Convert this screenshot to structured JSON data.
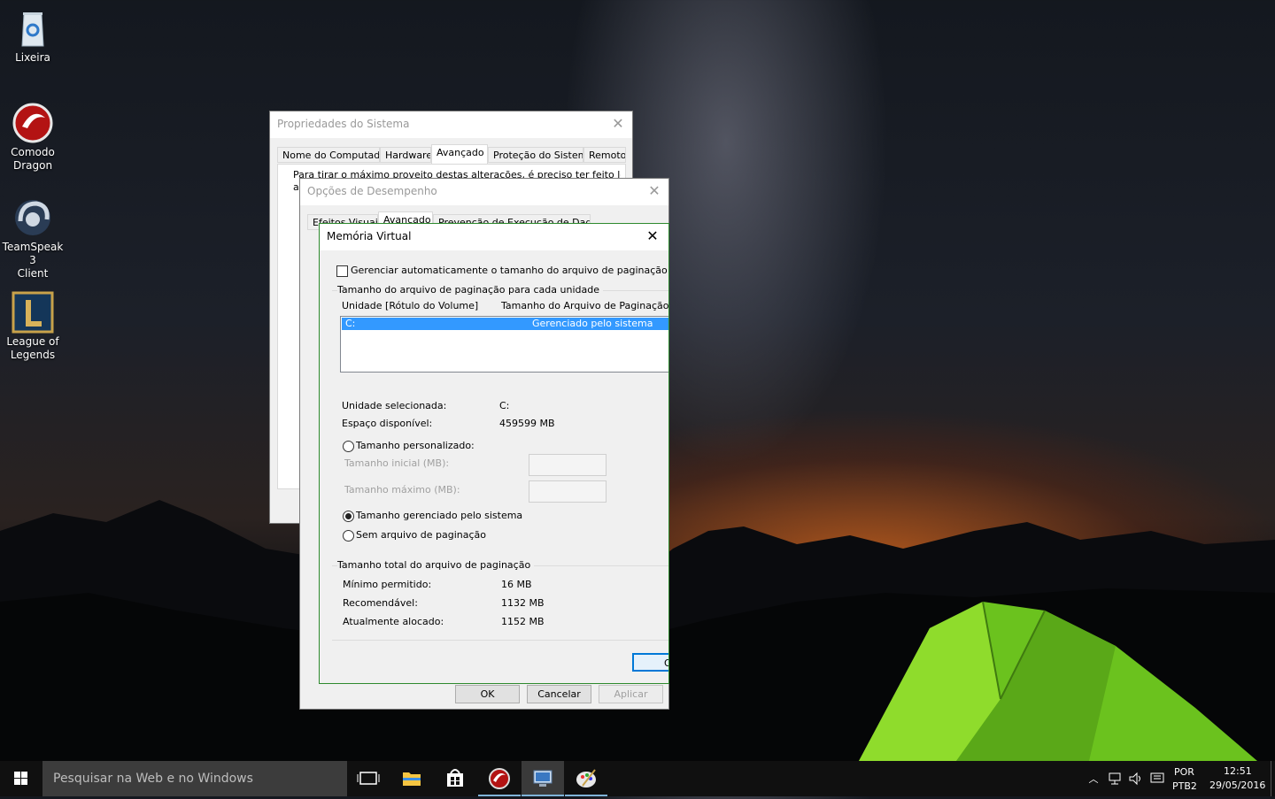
{
  "desktop": {
    "icons": [
      {
        "label": "Lixeira"
      },
      {
        "label": "Comodo\nDragon"
      },
      {
        "label": "TeamSpeak 3\nClient"
      },
      {
        "label": "League of\nLegends"
      }
    ]
  },
  "system_properties": {
    "title": "Propriedades do Sistema",
    "tabs": [
      "Nome do Computador",
      "Hardware",
      "Avançado",
      "Proteção do Sistema",
      "Remoto"
    ],
    "active_tab": "Avançado",
    "intro_text": "Para tirar o máximo proveito destas alterações, é preciso ter feito logon como",
    "intro_text_2": "ad"
  },
  "performance_options": {
    "title": "Opções de Desempenho",
    "tabs": [
      "Efeitos Visuais",
      "Avançado",
      "Prevenção de Execução de Dados"
    ],
    "buttons": {
      "ok": "OK",
      "cancel": "Cancelar",
      "apply": "Aplicar"
    }
  },
  "virtual_memory": {
    "title": "Memória Virtual",
    "auto_manage_label": "Gerenciar automaticamente o tamanho do arquivo de paginação de",
    "auto_manage_checked": false,
    "group_per_drive": "Tamanho do arquivo de paginação para cada unidade",
    "col_drive": "Unidade [Rótulo do Volume]",
    "col_size": "Tamanho do Arquivo de Paginação",
    "rows": [
      {
        "drive": "C:",
        "size": "Gerenciado pelo sistema"
      }
    ],
    "selected_drive_label": "Unidade selecionada:",
    "selected_drive_value": "C:",
    "free_space_label": "Espaço disponível:",
    "free_space_value": "459599 MB",
    "custom_size_label": "Tamanho personalizado:",
    "initial_size_label": "Tamanho inicial (MB):",
    "max_size_label": "Tamanho máximo (MB):",
    "system_managed_label": "Tamanho gerenciado pelo sistema",
    "no_paging_label": "Sem arquivo de paginação",
    "selected_option": "system_managed",
    "group_total": "Tamanho total do arquivo de paginação",
    "min_allowed_label": "Mínimo permitido:",
    "min_allowed_value": "16 MB",
    "recommended_label": "Recomendável:",
    "recommended_value": "1132 MB",
    "allocated_label": "Atualmente alocado:",
    "allocated_value": "1152 MB",
    "ok_partial": "O"
  },
  "taskbar": {
    "search_placeholder": "Pesquisar na Web e no Windows",
    "language": "POR",
    "layout": "PTB2",
    "time": "12:51",
    "date": "29/05/2016"
  },
  "colors": {
    "accent": "#3399ff",
    "vm_border": "#2d8a2d",
    "taskbar": "#101010"
  }
}
